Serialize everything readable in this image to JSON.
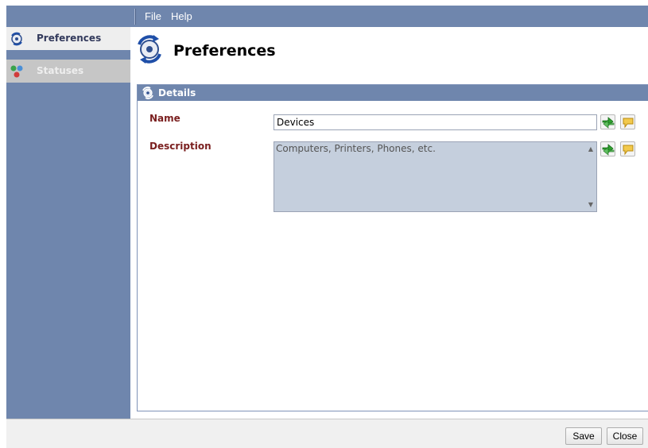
{
  "menubar": {
    "items": [
      "File",
      "Help"
    ]
  },
  "sidebar": {
    "items": [
      {
        "label": "Preferences",
        "icon": "preferences-icon",
        "selected": true
      },
      {
        "label": "Statuses",
        "icon": "statuses-icon",
        "selected": false
      }
    ]
  },
  "main": {
    "title": "Preferences",
    "details": {
      "header": "Details",
      "name_label": "Name",
      "name_value": "Devices",
      "description_label": "Description",
      "description_value": "Computers, Printers, Phones, etc."
    }
  },
  "footer": {
    "save_label": "Save",
    "close_label": "Close"
  },
  "colors": {
    "menubar_bg": "#6f86ad",
    "sidebar_bg": "#6f86ad",
    "label_color": "#7a1f1f",
    "description_bg": "#c5cfdd"
  }
}
